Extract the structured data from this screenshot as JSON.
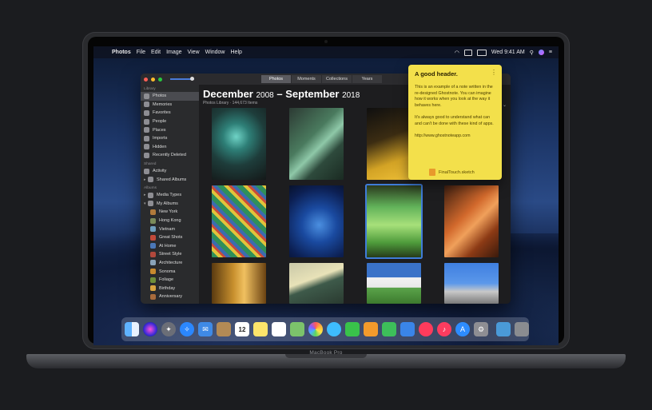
{
  "device": {
    "model_label": "MacBook Pro"
  },
  "menubar": {
    "app_name": "Photos",
    "menus": [
      "File",
      "Edit",
      "Image",
      "View",
      "Window",
      "Help"
    ],
    "clock": "Wed 9:41 AM"
  },
  "photos_window": {
    "tabs": [
      {
        "label": "Photos",
        "selected": true
      },
      {
        "label": "Moments",
        "selected": false
      },
      {
        "label": "Collections",
        "selected": false
      },
      {
        "label": "Years",
        "selected": false
      }
    ],
    "sidebar": {
      "library_heading": "Library",
      "library_items": [
        "Photos",
        "Memories",
        "Favorites",
        "People",
        "Places",
        "Imports",
        "Hidden",
        "Recently Deleted"
      ],
      "shared_heading": "Shared",
      "shared_items": [
        "Activity",
        "Shared Albums"
      ],
      "albums_heading": "Albums",
      "album_groups": [
        "Media Types",
        "My Albums"
      ],
      "my_albums": [
        "New York",
        "Hong Kong",
        "Vietnam",
        "Great Shots",
        "At Home",
        "Street Style",
        "Architecture",
        "Sonoma",
        "Foliage",
        "Birthday",
        "Anniversary"
      ]
    },
    "header": {
      "month_start": "December",
      "year_start": "2008",
      "dash": "–",
      "month_end": "September",
      "year_end": "2018",
      "subtitle": "Photos Library · 144,673 Items"
    }
  },
  "note": {
    "header": "A good header.",
    "body": "This is an example of a note written in the re-designed Ghostnote. You can imagine how it works when you look at the way it behaves here.\n\nIt's always good to understand what can and can't be done with these kind of apps.\n\nhttp://www.ghostnoteapp.com",
    "attachment": "FinalTouch.sketch"
  },
  "dock": {
    "apps": [
      "finder",
      "siri",
      "launchpad",
      "safari",
      "mail",
      "contacts",
      "calendar",
      "notes",
      "reminders",
      "maps",
      "photos",
      "messages",
      "facetime",
      "pages",
      "numbers",
      "keynote",
      "news",
      "music",
      "app-store",
      "system-preferences",
      "downloads",
      "trash"
    ],
    "calendar_day": "12"
  },
  "colors": {
    "note_bg": "#f3e04b",
    "accent": "#4a7bd8"
  }
}
